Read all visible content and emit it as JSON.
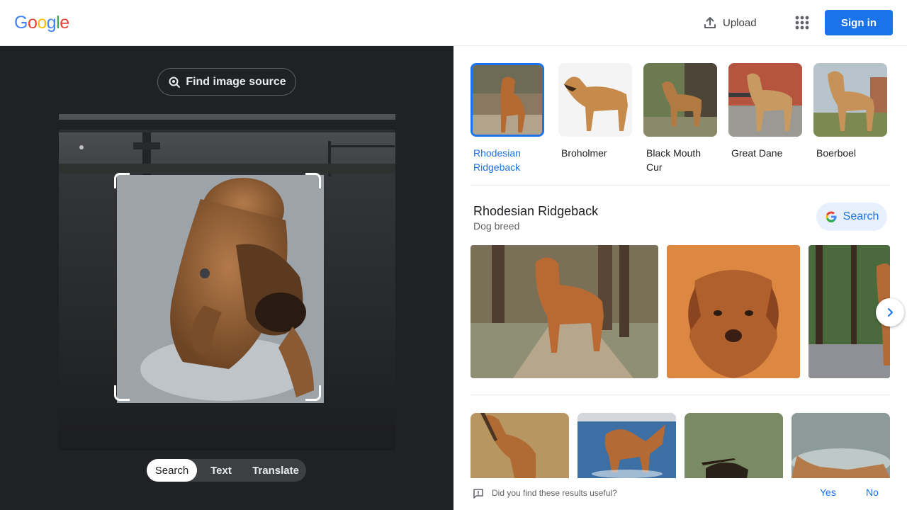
{
  "header": {
    "logo_letters": [
      "G",
      "o",
      "o",
      "g",
      "l",
      "e"
    ],
    "upload_label": "Upload",
    "signin_label": "Sign in"
  },
  "colors": {
    "accent": "#1a73e8",
    "logo": [
      "#4285F4",
      "#EA4335",
      "#FBBC05",
      "#4285F4",
      "#34A853",
      "#EA4335"
    ]
  },
  "lens": {
    "find_source_label": "Find image source",
    "modes": [
      "Search",
      "Text",
      "Translate"
    ],
    "active_mode": "Search"
  },
  "matches": [
    {
      "label": "Rhodesian Ridgeback",
      "selected": true
    },
    {
      "label": "Broholmer",
      "selected": false
    },
    {
      "label": "Black Mouth Cur",
      "selected": false
    },
    {
      "label": "Great Dane",
      "selected": false
    },
    {
      "label": "Boerboel",
      "selected": false
    }
  ],
  "entity": {
    "title": "Rhodesian Ridgeback",
    "subtitle": "Dog breed",
    "search_label": "Search"
  },
  "feedback": {
    "question": "Did you find these results useful?",
    "yes": "Yes",
    "no": "No"
  },
  "icons": {
    "upload": "upload-icon",
    "apps": "apps-grid-icon",
    "lens": "lens-search-icon",
    "next": "chevron-right-icon",
    "feedback": "feedback-icon",
    "google_g": "google-g-icon"
  }
}
